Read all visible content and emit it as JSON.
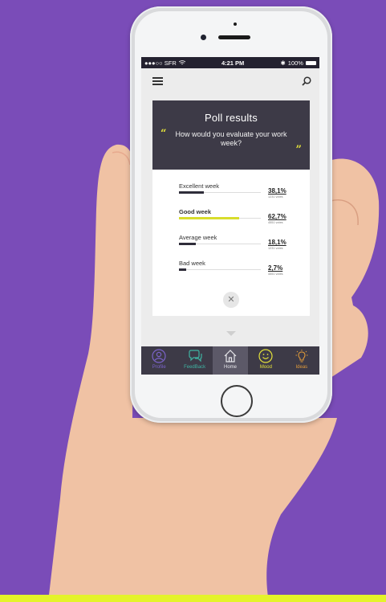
{
  "status_bar": {
    "carrier": "●●●○○ SFR",
    "time": "4:21 PM",
    "battery": "100%"
  },
  "poll": {
    "title": "Poll results",
    "question": "How would you evaluate your work week?",
    "results": [
      {
        "label": "Excellent week",
        "percent": "38,1%",
        "votes": "1231 votes",
        "fraction": 0.3,
        "highlight": false
      },
      {
        "label": "Good week",
        "percent": "62,7%",
        "votes": "4551 votes",
        "fraction": 0.74,
        "highlight": true
      },
      {
        "label": "Average week",
        "percent": "18,1%",
        "votes": "1231 votes",
        "fraction": 0.21,
        "highlight": false
      },
      {
        "label": "Bad week",
        "percent": "2,7%",
        "votes": "4551 votes",
        "fraction": 0.09,
        "highlight": false
      }
    ]
  },
  "tabs": [
    {
      "label": "Profile",
      "icon": "profile-icon",
      "color": "#7b63c9"
    },
    {
      "label": "FeedBack",
      "icon": "chat-icon",
      "color": "#3fb3a2"
    },
    {
      "label": "Home",
      "icon": "home-icon",
      "color": "#cfcfd6",
      "active": true
    },
    {
      "label": "Mood",
      "icon": "smiley-icon",
      "color": "#e4e23a"
    },
    {
      "label": "Ideas",
      "icon": "lightbulb-icon",
      "color": "#e09a3a"
    }
  ],
  "colors": {
    "background": "#7a4cb8",
    "accent": "#d8dd2c",
    "dark": "#3d3a47"
  }
}
